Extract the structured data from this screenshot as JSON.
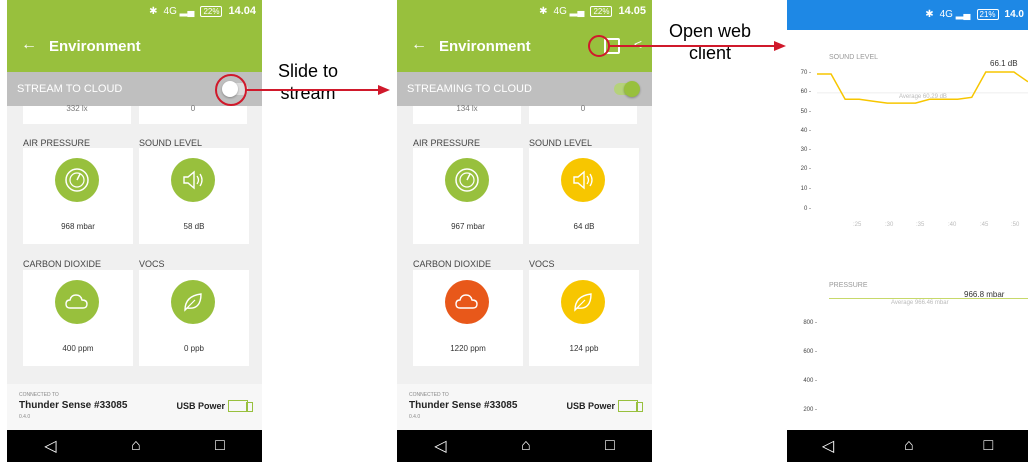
{
  "status": {
    "p1": {
      "battery": "22%",
      "time": "14.04"
    },
    "p2": {
      "battery": "22%",
      "time": "14.05"
    },
    "p3": {
      "battery": "21%",
      "time": "14.0"
    }
  },
  "app": {
    "title": "Environment"
  },
  "phone1": {
    "cloud_label": "STREAM TO CLOUD",
    "clipped": [
      "332 lx",
      "0"
    ],
    "air_pressure": "AIR PRESSURE",
    "sound_level": "SOUND LEVEL",
    "pressure_value": "968 mbar",
    "sound_value": "58 dB",
    "carbon_dioxide": "CARBON DIOXIDE",
    "vocs": "VOCS",
    "co2_value": "400 ppm",
    "vocs_value": "0 ppb"
  },
  "phone2": {
    "cloud_label": "STREAMING TO CLOUD",
    "clipped": [
      "134 lx",
      "0"
    ],
    "air_pressure": "AIR PRESSURE",
    "sound_level": "SOUND LEVEL",
    "pressure_value": "967 mbar",
    "sound_value": "64 dB",
    "carbon_dioxide": "CARBON DIOXIDE",
    "vocs": "VOCS",
    "co2_value": "1220 ppm",
    "vocs_value": "124 ppb"
  },
  "footer": {
    "connected": "CONNECTED TO",
    "device": "Thunder Sense #33085",
    "version": "0.4.0",
    "power": "USB Power"
  },
  "annotations": {
    "slide": "Slide to stream",
    "web": "Open web client"
  },
  "web": {
    "sound_title": "SOUND LEVEL",
    "sound_current": "66.1 dB",
    "sound_average": "Average 60.29 dB",
    "sound_yticks": [
      "70 -",
      "60 -",
      "50 -",
      "40 -",
      "30 -",
      "20 -",
      "10 -",
      "0 -"
    ],
    "sound_xticks": [
      ":25",
      ":30",
      ":35",
      ":40",
      ":45",
      ":50"
    ],
    "pressure_title": "PRESSURE",
    "pressure_current": "966.8 mbar",
    "pressure_average": "Average 966.46 mbar",
    "pressure_yticks": [
      "800 -",
      "600 -",
      "400 -",
      "200 -"
    ]
  },
  "colors": {
    "green": "#98c03d",
    "yellow": "#f7c600",
    "orange": "#e8581a",
    "web_blue": "#1e88e5",
    "annotation_red": "#d0192b"
  },
  "chart_data": {
    "type": "line",
    "title": "SOUND LEVEL",
    "xlabel": "",
    "ylabel": "",
    "ylim": [
      0,
      70
    ],
    "categories": [
      ":25",
      ":30",
      ":35",
      ":40",
      ":45",
      ":50"
    ],
    "series": [
      {
        "values": [
          70,
          70,
          57,
          57,
          56,
          55,
          55,
          55,
          57,
          57,
          57,
          58,
          71,
          71,
          71,
          66
        ]
      }
    ]
  }
}
